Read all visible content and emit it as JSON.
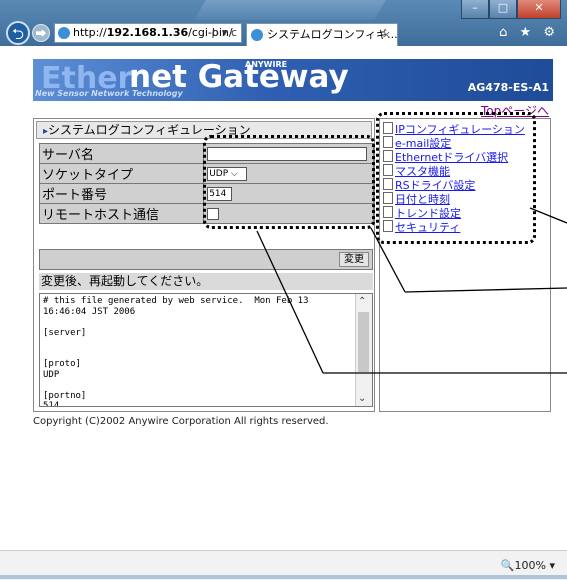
{
  "browser": {
    "address_prefix": "http://",
    "address_host": "192.168.1.36",
    "address_path": "/cgi-bin/",
    "address_controls": "ρ ▾ c",
    "tab_title": "システムログコンフィギ...",
    "tab_close": "×",
    "toolbar_icons": "⌂ ★ ⚙",
    "back": "⮌",
    "forward": "⮕",
    "zoom": "🔍100%  ▾"
  },
  "banner": {
    "word1": "Ether",
    "word2": "net Gateway",
    "anywire": "ANYWIRE",
    "subtitle": "New Sensor Network Technology",
    "model": "AG478-ES-A1"
  },
  "top_link": "Topページへ",
  "panel": {
    "title": "システムログコンフィギュレーション",
    "rows": [
      {
        "label": "サーバ名",
        "value": ""
      },
      {
        "label": "ソケットタイプ",
        "value": "UDP"
      },
      {
        "label": "ポート番号",
        "value": "514"
      },
      {
        "label": "リモートホスト通信",
        "value": ""
      }
    ],
    "change_button": "変更",
    "message": "変更後、再起動してください。",
    "log": "# this file generated by web service.  Mon Feb 13\n16:46:04 JST 2006\n\n[server]\n\n\n[proto]\nUDP\n\n[portno]\n514"
  },
  "nav": {
    "items": [
      "IPコンフィギュレーション",
      "e-mail設定",
      "Ethernetドライバ選択",
      "マスタ機能",
      "RSドライバ設定",
      "日付と時刻",
      "トレンド設定",
      "セキュリティ"
    ]
  },
  "copyright": "Copyright (C)2002 Anywire Corporation All rights reserved."
}
